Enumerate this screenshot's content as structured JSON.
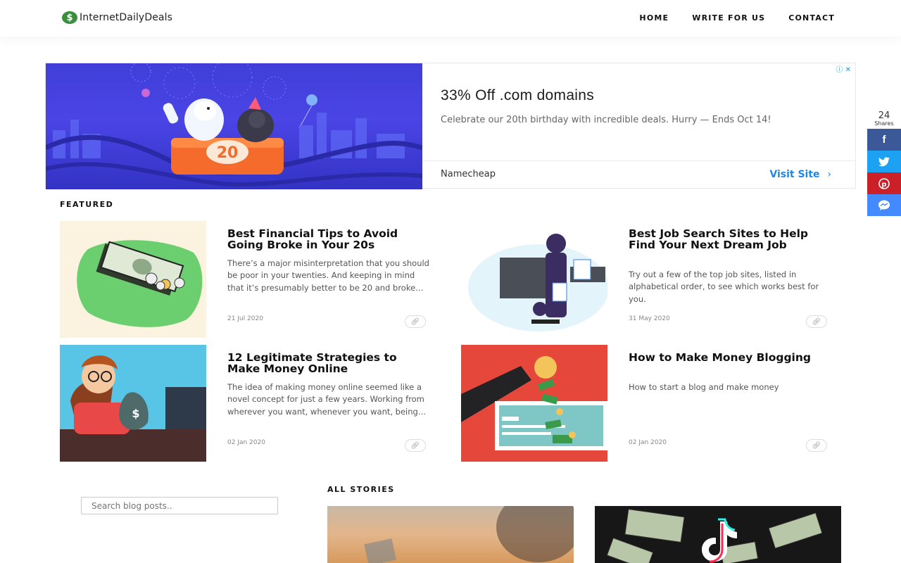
{
  "header": {
    "logo_text": "InternetDailyDeals",
    "nav": [
      "HOME",
      "WRITE FOR US",
      "CONTACT"
    ]
  },
  "ad": {
    "title": "33% Off .com domains",
    "description": "Celebrate our 20th birthday with incredible deals. Hurry — Ends Oct 14!",
    "brand": "Namecheap",
    "cta": "Visit Site",
    "badge_number": "20"
  },
  "share": {
    "count": "24",
    "label": "Shares",
    "buttons": [
      {
        "name": "facebook",
        "color": "#3b5998",
        "glyph": "f"
      },
      {
        "name": "twitter",
        "color": "#1da1f2",
        "glyph": "twitter-bird"
      },
      {
        "name": "pinterest",
        "color": "#cb2027",
        "glyph": "pinterest-p"
      },
      {
        "name": "messenger",
        "color": "#448aff",
        "glyph": "messenger-bubble"
      }
    ]
  },
  "featured": {
    "label": "FEATURED",
    "posts": [
      {
        "title": "Best Financial Tips to Avoid Going Broke in Your 20s",
        "excerpt": "There’s a major misinterpretation that you should be poor in your twenties. And keeping in mind that it’s presumably better to be 20 and broke…",
        "date": "21 Jul 2020"
      },
      {
        "title": "Best Job Search Sites to Help Find Your Next Dream Job",
        "excerpt": "Try out a few of the top job sites, listed in alphabetical order, to see which works best for you.",
        "date": "31 May 2020"
      },
      {
        "title": "12 Legitimate Strategies to Make Money Online",
        "excerpt": "The idea of making money online seemed like a novel concept for just a few years. Working from wherever you want, whenever you want, being…",
        "date": "02 Jan 2020"
      },
      {
        "title": "How to Make Money Blogging",
        "excerpt": "How to start a blog and make money",
        "date": "02 Jan 2020"
      }
    ]
  },
  "all_stories": {
    "label": "ALL STORIES"
  },
  "search": {
    "placeholder": "Search blog posts.."
  },
  "colors": {
    "link_blue": "#1f87e6",
    "logo_green": "#3a8f3c"
  }
}
